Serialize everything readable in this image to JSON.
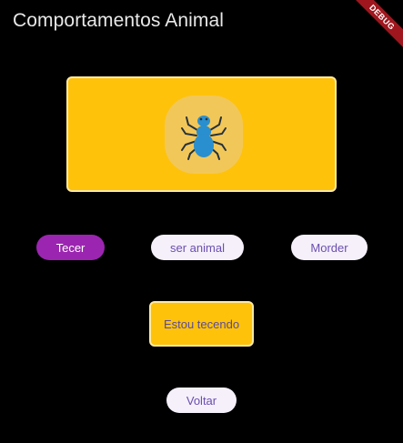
{
  "app_bar": {
    "title": "Comportamentos Animal"
  },
  "debug_banner": {
    "label": "DEBUG",
    "color": "#a0161e"
  },
  "hero": {
    "icon": "spider-icon",
    "card_color": "#fec20b",
    "icon_color": "#2a8fce"
  },
  "actions": [
    {
      "label": "Tecer",
      "selected": true,
      "color": "#9b25b0"
    },
    {
      "label": "ser animal",
      "selected": false
    },
    {
      "label": "Morder",
      "selected": false
    }
  ],
  "status": {
    "text": "Estou tecendo"
  },
  "back_button": {
    "label": "Voltar"
  }
}
